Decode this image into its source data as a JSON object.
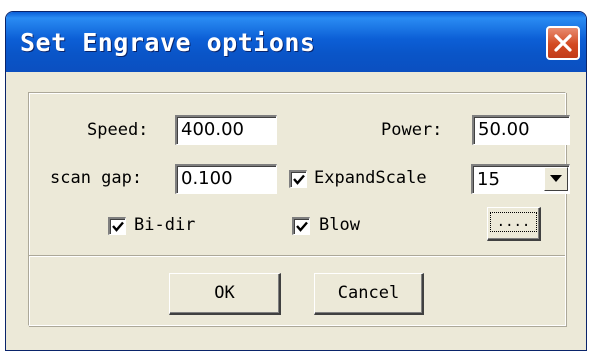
{
  "window": {
    "title": "Set Engrave options"
  },
  "form": {
    "speed_label": "Speed:",
    "speed_value": "400.00",
    "power_label": "Power:",
    "power_value": "50.00",
    "scan_gap_label": "scan gap:",
    "scan_gap_value": "0.100",
    "expand_scale_label": "ExpandScale",
    "expand_scale_checked": true,
    "expand_scale_value": "15",
    "bidir_label": "Bi-dir",
    "bidir_checked": true,
    "blow_label": "Blow",
    "blow_checked": true,
    "browse_label": "...."
  },
  "buttons": {
    "ok_label": "OK",
    "cancel_label": "Cancel"
  },
  "icons": {
    "close": "close-x-icon",
    "check": "checkmark-icon",
    "dropdown": "chevron-down-icon"
  },
  "colors": {
    "titlebar": "#0a55c8",
    "close": "#d34a22",
    "dialog_bg": "#ece9d8"
  }
}
